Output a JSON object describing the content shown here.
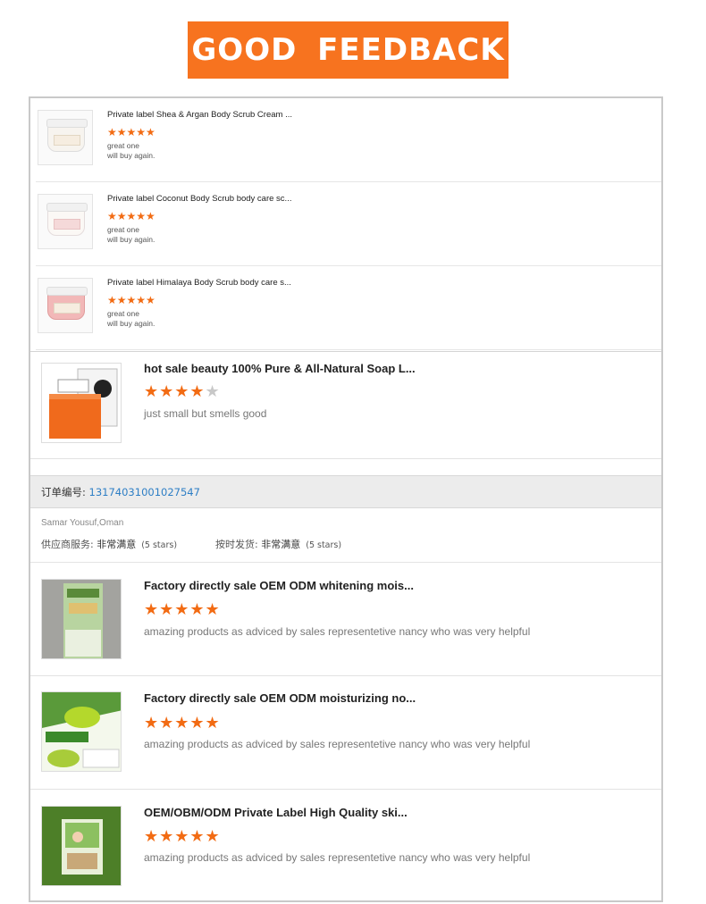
{
  "banner": {
    "title": "GOOD  FEEDBACK"
  },
  "small_reviews": [
    {
      "title": "Private label Shea & Argan Body Scrub Cream ...",
      "stars": "★★★★★",
      "comment_line1": "great one",
      "comment_line2": "will buy again."
    },
    {
      "title": "Private label Coconut Body Scrub body care sc...",
      "stars": "★★★★★",
      "comment_line1": "great one",
      "comment_line2": "will buy again."
    },
    {
      "title": "Private label Himalaya Body Scrub body care s...",
      "stars": "★★★★★",
      "comment_line1": "great one",
      "comment_line2": "will buy again."
    }
  ],
  "soap_review": {
    "title": "hot sale beauty 100% Pure & All-Natural Soap L...",
    "stars_on": "★★★★",
    "stars_off": "★",
    "rating": 4,
    "comment": "just small but smells good"
  },
  "order": {
    "label": "订单编号: ",
    "number": "13174031001027547"
  },
  "buyer": {
    "name": "Samar Yousuf,Oman",
    "service_label": "供应商服务: ",
    "service_value": "非常满意",
    "service_stars": "(5 stars)",
    "shipping_label": "按时发货: ",
    "shipping_value": "非常满意",
    "shipping_stars": "(5 stars)"
  },
  "large_reviews": [
    {
      "title": "Factory directly sale OEM ODM whitening mois...",
      "stars": "★★★★★",
      "comment": "amazing products as adviced by sales representetive nancy who was very helpful"
    },
    {
      "title": "Factory directly sale OEM ODM moisturizing no...",
      "stars": "★★★★★",
      "comment": "amazing products as adviced by sales representetive nancy who was very helpful"
    },
    {
      "title": "OEM/OBM/ODM Private Label High Quality ski...",
      "stars": "★★★★★",
      "comment": "amazing products as adviced by sales representetive nancy who was very helpful"
    }
  ],
  "colors": {
    "accent": "#f7731f",
    "star": "#f26b13",
    "link": "#2d7ec5"
  }
}
